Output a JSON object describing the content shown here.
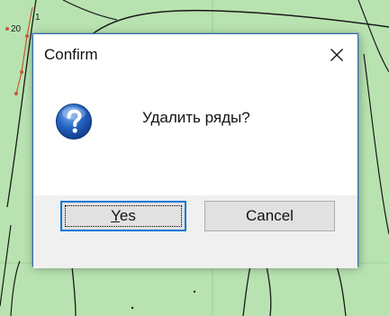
{
  "background": {
    "labels": [
      "20",
      "1"
    ],
    "colors": {
      "land": "#b8e3b0",
      "contour": "#1a1a1a",
      "marker": "#c85a3a"
    }
  },
  "dialog": {
    "title": "Confirm",
    "close_icon": "close-icon",
    "icon": "question-icon",
    "message": "Удалить ряды?",
    "buttons": {
      "yes_label": "Yes",
      "cancel_label": "Cancel"
    },
    "colors": {
      "border": "#2f6db5",
      "button_bar": "#f0f0f0",
      "button": "#e1e1e1",
      "focus_border": "#0a78d7",
      "icon_blue": "#1f5fb8"
    }
  }
}
